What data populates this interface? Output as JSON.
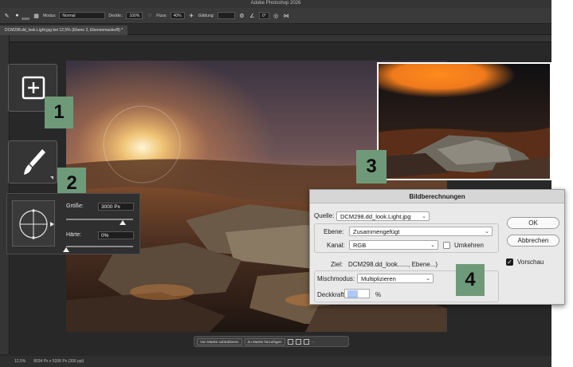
{
  "app": {
    "title": "Adobe Photoshop 2026"
  },
  "options_bar": {
    "brush_size": "3000",
    "mode_label": "Modus:",
    "mode_value": "Normal",
    "opacity_label": "Deckkr.:",
    "opacity_value": "100%",
    "flow_label": "Fluss:",
    "flow_value": "40%",
    "smoothing_label": "Glättung:",
    "angle_value": "0°"
  },
  "document": {
    "tab_label": "DCM298.dd_look.Light.jpg bei 12,5% (Ebene 2, Ebenenmaske/8) *"
  },
  "status_bar": {
    "zoom": "12,5%",
    "doc_size": "8034 Px x 5336 Px (300 ppi)"
  },
  "task_bar": {
    "subtract_label": "Von Maske subtrahieren",
    "add_label": "Zu Maske hinzufügen",
    "more_label": "···"
  },
  "badges": {
    "one": "1",
    "two": "2",
    "three": "3",
    "four": "4"
  },
  "brush_panel": {
    "size_label": "Größe:",
    "size_value": "3000 Px",
    "size_level": 0.85,
    "hardness_label": "Härte:",
    "hardness_value": "0%",
    "hardness_level": 0
  },
  "dialog": {
    "title": "Bildberechnungen",
    "source_label": "Quelle:",
    "source_value": "DCM298.dd_look.Light.jpg",
    "layer_label": "Ebene:",
    "layer_value": "Zusammengefügt",
    "channel_label": "Kanal:",
    "channel_value": "RGB",
    "invert_label": "Umkehren",
    "invert_checked": false,
    "target_label": "Ziel:",
    "target_value": "DCM298.dd_look......, Ebene...)",
    "blend_label": "Mischmodus:",
    "blend_value": "Multiplizieren",
    "opacity_label": "Deckkraft:",
    "opacity_value": "100",
    "opacity_unit": "%",
    "ok_label": "OK",
    "cancel_label": "Abbrechen",
    "preview_label": "Vorschau",
    "preview_checked": true
  },
  "colors": {
    "badge_green": "#6f9a7a",
    "app_dark": "#282828",
    "dialog_bg": "#e9e9e9",
    "sunset_orange": "#f07a1c"
  }
}
